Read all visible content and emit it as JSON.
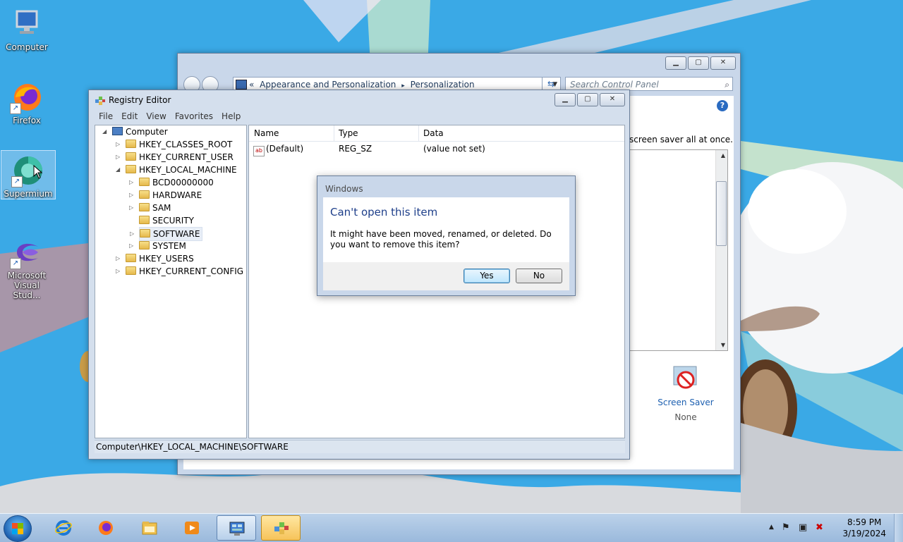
{
  "desktop": {
    "icons": [
      {
        "label": "Computer",
        "icon": "computer-icon"
      },
      {
        "label": "Firefox",
        "icon": "firefox-icon"
      },
      {
        "label": "Supermium",
        "icon": "supermium-icon"
      },
      {
        "label": "Microsoft Visual Stud...",
        "icon": "visual-studio-icon"
      }
    ]
  },
  "control_panel": {
    "breadcrumb_prefix": "«",
    "breadcrumb": [
      "Appearance and Personalization",
      "Personalization"
    ],
    "breadcrumb_sep": "▸",
    "search_placeholder": "Search Control Panel",
    "body_text": "screen saver all at once.",
    "screen_saver_label": "Screen Saver",
    "screen_saver_value": "None",
    "help": "?"
  },
  "registry_editor": {
    "title": "Registry Editor",
    "menu": [
      "File",
      "Edit",
      "View",
      "Favorites",
      "Help"
    ],
    "tree": {
      "root": "Computer",
      "hives": [
        "HKEY_CLASSES_ROOT",
        "HKEY_CURRENT_USER",
        "HKEY_LOCAL_MACHINE",
        "HKEY_USERS",
        "HKEY_CURRENT_CONFIG"
      ],
      "hklm_children": [
        "BCD00000000",
        "HARDWARE",
        "SAM",
        "SECURITY",
        "SOFTWARE",
        "SYSTEM"
      ],
      "selected": "SOFTWARE"
    },
    "columns": [
      "Name",
      "Type",
      "Data"
    ],
    "values": [
      {
        "name": "(Default)",
        "type": "REG_SZ",
        "data": "(value not set)"
      }
    ],
    "status_path": "Computer\\HKEY_LOCAL_MACHINE\\SOFTWARE"
  },
  "dialog": {
    "title": "Windows",
    "heading": "Can't open this item",
    "message": "It might have been moved, renamed, or deleted. Do you want to remove this item?",
    "yes": "Yes",
    "no": "No"
  },
  "taskbar": {
    "pinned": [
      "internet-explorer-icon",
      "firefox-icon",
      "file-explorer-icon",
      "media-player-icon",
      "control-panel-icon",
      "registry-editor-icon"
    ],
    "clock_time": "8:59 PM",
    "clock_date": "3/19/2024"
  },
  "colors": {
    "dialog_heading": "#1e3f8a",
    "link_blue": "#1c5fb0",
    "window_frame": "#c9d7ea",
    "taskbar": "#9ab9dc"
  }
}
